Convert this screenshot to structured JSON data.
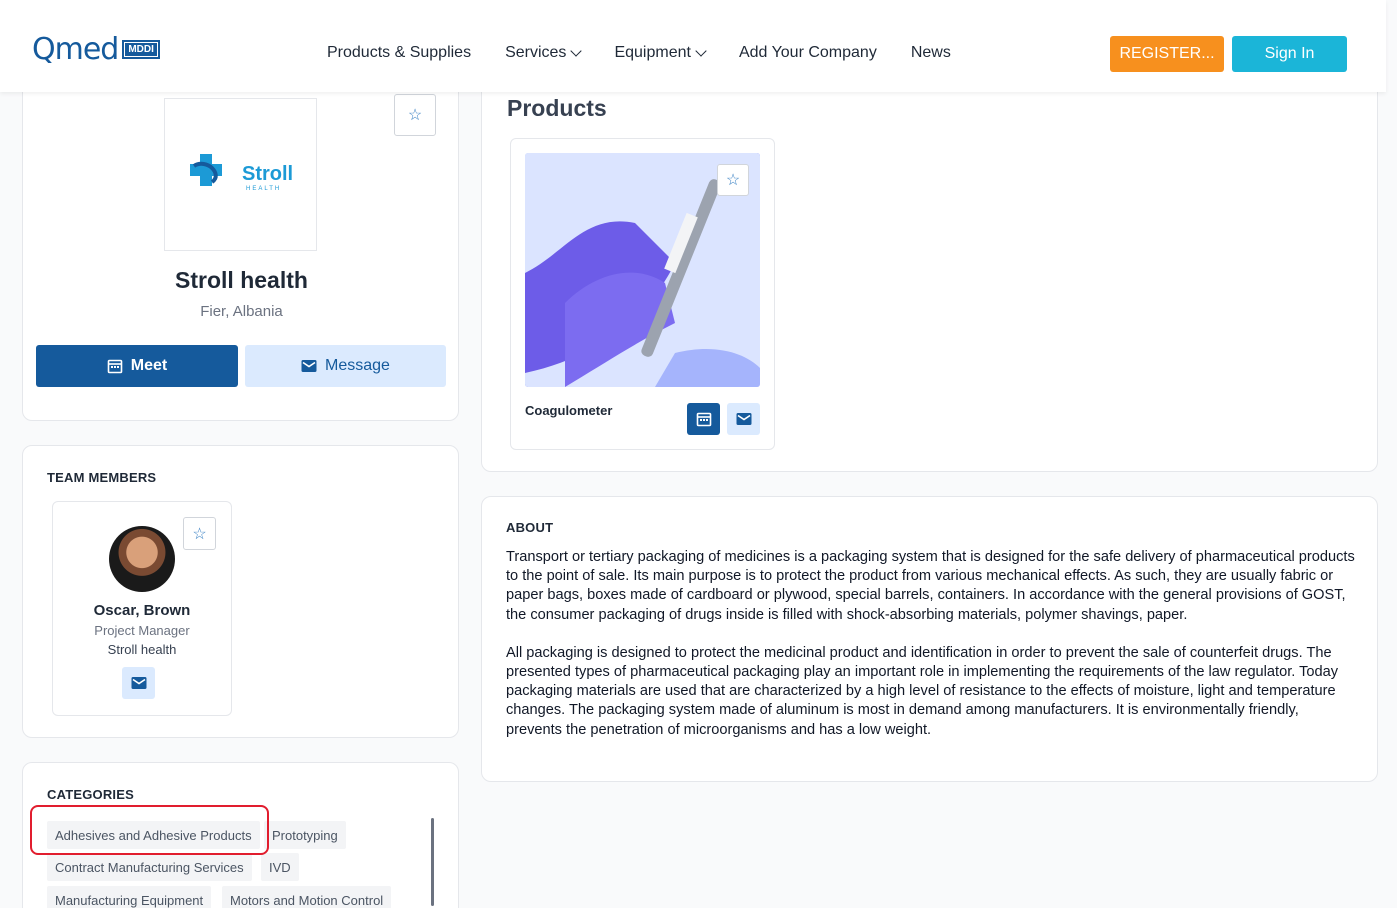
{
  "header": {
    "logo_text": "Qmed",
    "logo_badge": "MDDI",
    "nav": [
      {
        "label": "Products & Supplies",
        "dropdown": false
      },
      {
        "label": "Services",
        "dropdown": true
      },
      {
        "label": "Equipment",
        "dropdown": true
      },
      {
        "label": "Add Your Company",
        "dropdown": false
      },
      {
        "label": "News",
        "dropdown": false
      }
    ],
    "register_label": "REGISTER...",
    "signin_label": "Sign In",
    "colors": {
      "register": "#f7901e",
      "signin": "#1bb5d8",
      "brand": "#155a9c"
    }
  },
  "profile": {
    "logo_name": "Stroll",
    "logo_sub": "HEALTH",
    "name": "Stroll health",
    "location": "Fier, Albania",
    "meet_label": "Meet",
    "message_label": "Message"
  },
  "team": {
    "title": "TEAM MEMBERS",
    "members": [
      {
        "name": "Oscar, Brown",
        "role": "Project Manager",
        "company": "Stroll health"
      }
    ]
  },
  "categories": {
    "title": "CATEGORIES",
    "items": [
      "Adhesives and Adhesive Products",
      "Prototyping",
      "Contract Manufacturing Services",
      "IVD",
      "Manufacturing Equipment",
      "Motors and Motion Control"
    ],
    "highlighted": "Adhesives and Adhesive Products"
  },
  "products": {
    "title": "Products",
    "items": [
      {
        "name": "Coagulometer"
      }
    ]
  },
  "about": {
    "title": "ABOUT",
    "paragraphs": [
      "Transport or tertiary packaging of medicines is a packaging system that is designed for the safe delivery of pharmaceutical products to the point of sale. Its main purpose is to protect the product from various mechanical effects. As such, they are usually fabric or paper bags, boxes made of cardboard or plywood, special barrels, containers. In accordance with the general provisions of GOST, the consumer packaging of drugs inside is filled with shock-absorbing materials, polymer shavings, paper.",
      "All packaging is designed to protect the medicinal product and identification in order to prevent the sale of counterfeit drugs. The presented types of pharmaceutical packaging play an important role in implementing the requirements of the law regulator. Today packaging materials are used that are characterized by a high level of resistance to the effects of moisture, light and temperature changes. The packaging system made of aluminum is most in demand among manufacturers. It is environmentally friendly, prevents the penetration of microorganisms and has a low weight."
    ]
  }
}
